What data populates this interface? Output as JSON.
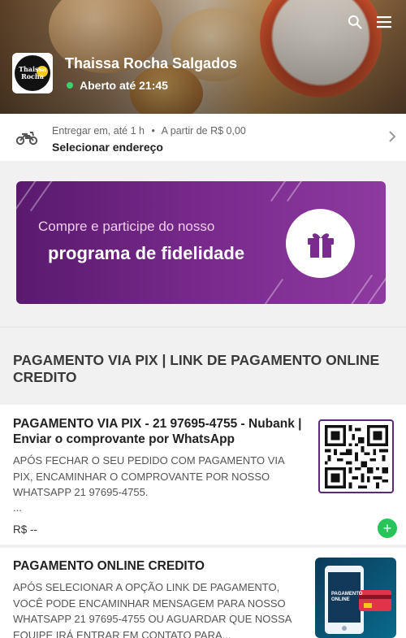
{
  "header": {
    "store_name": "Thaissa Rocha Salgados",
    "status": "Aberto até 21:45",
    "logo_text": "Thaissa Rocha",
    "icons": [
      "search-icon",
      "menu-icon"
    ]
  },
  "delivery": {
    "prefix": "Entregar em,",
    "time": "até 1 h",
    "bullet": "•",
    "min_price": "A partir de R$ 0,00",
    "action": "Selecionar endereço"
  },
  "banner": {
    "line1": "Compre e participe do nosso",
    "line2": "programa de fidelidade",
    "icon": "gift-icon"
  },
  "section": {
    "title": "PAGAMENTO VIA PIX | LINK DE PAGAMENTO ONLINE CREDITO"
  },
  "products": [
    {
      "title": "PAGAMENTO VIA PIX - 21 97695-4755 - Nubank | Enviar o comprovante por WhatsApp",
      "description": "APÓS FECHAR O SEU PEDIDO COM PAGAMENTO VIA PIX, ENCAMINHAR O COMPROVANTE POR NOSSO WHATSAPP 21 97695-4755.",
      "ellipsis": "...",
      "price": "R$ --",
      "add_label": "+"
    },
    {
      "title": "PAGAMENTO ONLINE CREDITO",
      "description": "APÓS SELECIONAR A OPÇÃO LINK DE PAGAMENTO, VOCÊ PODE ENCAMINHAR MENSAGEM PARA NOSSO WHATSAPP 21 97695-4755 OU AGUARDAR QUE NOSSA EQUIPE IRÁ ENTRAR EM CONTATO PARA...",
      "image_text": "PAGAMENTO ONLINE"
    }
  ],
  "colors": {
    "accent_purple": "#7a2b8e",
    "status_green": "#3bd16f",
    "add_green": "#29c459"
  }
}
